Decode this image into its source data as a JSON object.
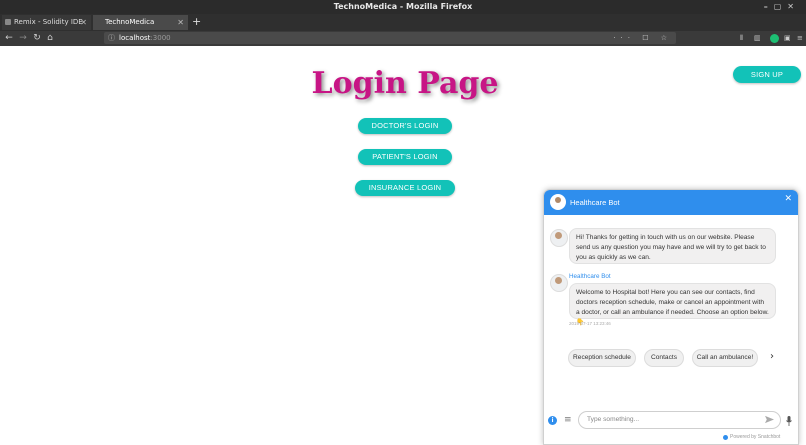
{
  "window": {
    "title": "TechnoMedica - Mozilla Firefox"
  },
  "tabs": [
    {
      "label": "Remix - Solidity IDE",
      "active": false
    },
    {
      "label": "TechnoMedica",
      "active": true
    }
  ],
  "urlbar": {
    "host": "localhost",
    "port": ":3000"
  },
  "page": {
    "title": "Login Page",
    "signup_label": "SIGN UP",
    "doctor_login_label": "DOCTOR'S LOGIN",
    "patient_login_label": "PATIENT'S LOGIN",
    "insurance_login_label": "INSURANCE LOGIN"
  },
  "chat": {
    "title": "Healthcare Bot",
    "messages": [
      {
        "text": "Hi! Thanks for getting in touch with us on our website. Please send us any question you may have and we will try to get back to you as quickly as we can."
      },
      {
        "sender": "Healthcare Bot",
        "text": "Welcome to Hospital bot! Here you can see our contacts, find doctors reception schedule, make or cancel an appointment with a doctor, or call an ambulance if needed. Choose an option below. 👇",
        "timestamp": "2019-07-17 13:23:46"
      }
    ],
    "quick_replies": [
      "Reception schedule",
      "Contacts",
      "Call an ambulance!"
    ],
    "input_placeholder": "Type something...",
    "powered_by": "Powered by Snatchbot"
  },
  "colors": {
    "accent": "#12c2b8",
    "title": "#c71585",
    "chat_header": "#2f8eed"
  }
}
